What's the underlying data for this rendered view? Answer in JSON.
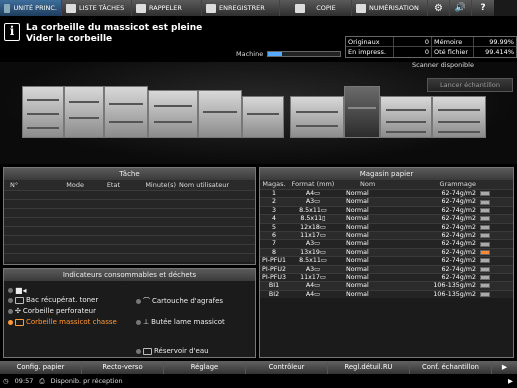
{
  "tabs": [
    {
      "label": "UNITÉ PRINC.",
      "active": true
    },
    {
      "label": "LISTE TÂCHES",
      "active": false
    },
    {
      "label": "RAPPELER",
      "active": false
    },
    {
      "label": "ENREGISTRER",
      "active": false
    },
    {
      "label": "COPIE",
      "active": false
    },
    {
      "label": "NUMÉRISATION",
      "active": false
    }
  ],
  "message": {
    "line1": "La corbeille du massicot est pleine",
    "line2": "Vider la corbeille"
  },
  "machine": {
    "label": "Machine",
    "progress": 0.2
  },
  "counters": {
    "originaux_label": "Originaux",
    "originaux_value": "0",
    "memoire_label": "Mémoire",
    "memoire_value": "99.99%",
    "en_impress_label": "En impress.",
    "en_impress_value": "0",
    "ote_fichier_label": "Oté fichier",
    "ote_fichier_value": "99.414%"
  },
  "scanner_status": "Scanner disponible",
  "sample_button": "Lancer échantillon",
  "tache": {
    "title": "Tâche",
    "columns": [
      "N°",
      "Mode",
      "Etat",
      "Minute(s)",
      "Nom utilisateur"
    ]
  },
  "consumables": {
    "title": "Indicateurs consommables et déchets",
    "items": [
      {
        "label": "Bac récupérat. toner",
        "alert": false
      },
      {
        "label": "Corbeille perforateur",
        "alert": false
      },
      {
        "label": "Corbeille massicot chasse",
        "alert": true
      },
      {
        "label": "Cartouche d'agrafes",
        "alert": false
      },
      {
        "label": "Butée lame massicot",
        "alert": false
      },
      {
        "label": "Réservoir d'eau",
        "alert": false
      }
    ]
  },
  "magasin": {
    "title": "Magasin papier",
    "columns": [
      "Magas.",
      "Format (mm)",
      "Nom",
      "Grammage"
    ],
    "rows": [
      {
        "mag": "1",
        "format": "A4▭",
        "name": "Normal",
        "grammage": "62-74g/m2",
        "low": false
      },
      {
        "mag": "2",
        "format": "A3▭",
        "name": "Normal",
        "grammage": "62-74g/m2",
        "low": false
      },
      {
        "mag": "3",
        "format": "8.5x11▭",
        "name": "Normal",
        "grammage": "62-74g/m2",
        "low": false
      },
      {
        "mag": "4",
        "format": "8.5x11▯",
        "name": "Normal",
        "grammage": "62-74g/m2",
        "low": false
      },
      {
        "mag": "5",
        "format": "12x18▭",
        "name": "Normal",
        "grammage": "62-74g/m2",
        "low": false
      },
      {
        "mag": "6",
        "format": "11x17▭",
        "name": "Normal",
        "grammage": "62-74g/m2",
        "low": false
      },
      {
        "mag": "7",
        "format": "A3▭",
        "name": "Normal",
        "grammage": "62-74g/m2",
        "low": false
      },
      {
        "mag": "8",
        "format": "13x19▭",
        "name": "Normal",
        "grammage": "62-74g/m2",
        "low": true
      },
      {
        "mag": "PI-PFU1",
        "format": "8.5x11▭",
        "name": "Normal",
        "grammage": "62-74g/m2",
        "low": false
      },
      {
        "mag": "PI-PFU2",
        "format": "A3▭",
        "name": "Normal",
        "grammage": "62-74g/m2",
        "low": false
      },
      {
        "mag": "PI-PFU3",
        "format": "11x17▭",
        "name": "Normal",
        "grammage": "62-74g/m2",
        "low": false
      },
      {
        "mag": "BI1",
        "format": "A4▭",
        "name": "Normal",
        "grammage": "106-135g/m2",
        "low": false
      },
      {
        "mag": "BI2",
        "format": "A4▭",
        "name": "Normal",
        "grammage": "106-135g/m2",
        "low": false
      }
    ]
  },
  "bottom_buttons": [
    "Config. papier",
    "Recto-verso",
    "Réglage",
    "Contrôleur",
    "Regl.détuil.RU",
    "Conf. échantillon"
  ],
  "status": {
    "time": "09:57",
    "text": "Disponib. pr réception"
  },
  "colors": {
    "active_tab": "#3f6e9c",
    "alert": "#ff9a3a"
  }
}
